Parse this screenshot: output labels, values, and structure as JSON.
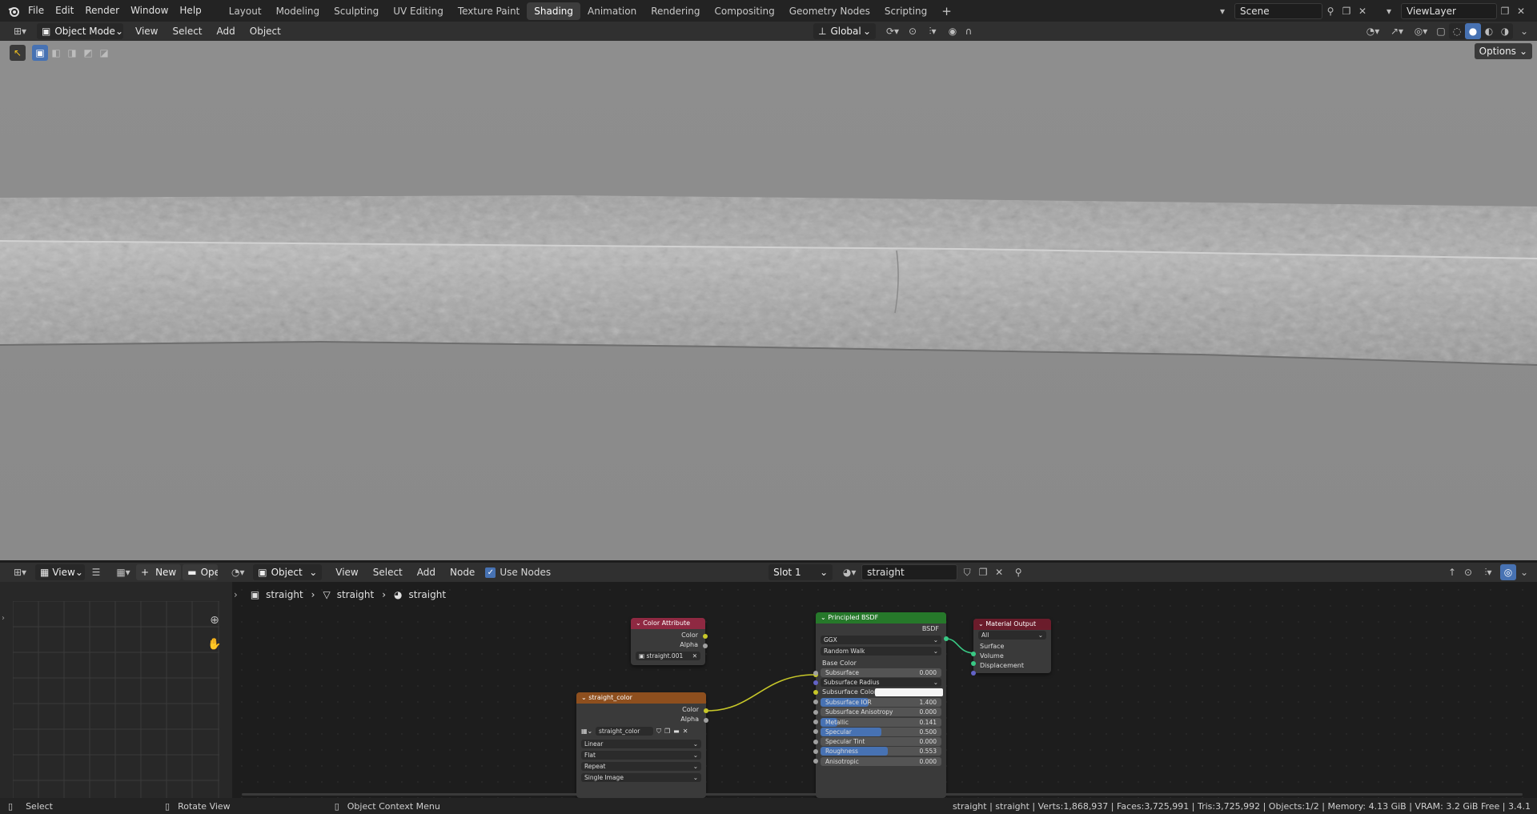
{
  "app": {
    "menus": [
      "File",
      "Edit",
      "Render",
      "Window",
      "Help"
    ],
    "workspaces": [
      "Layout",
      "Modeling",
      "Sculpting",
      "UV Editing",
      "Texture Paint",
      "Shading",
      "Animation",
      "Rendering",
      "Compositing",
      "Geometry Nodes",
      "Scripting"
    ],
    "active_workspace": "Shading",
    "scene": "Scene",
    "view_layer": "ViewLayer"
  },
  "viewport_header": {
    "mode": "Object Mode",
    "menus": [
      "View",
      "Select",
      "Add",
      "Object"
    ],
    "orientation": "Global",
    "options": "Options"
  },
  "node_header": {
    "view": "View",
    "new_label": "New",
    "open_label": "Ope",
    "object_label": "Object",
    "menus": [
      "View",
      "Select",
      "Add",
      "Node"
    ],
    "use_nodes": "Use Nodes",
    "slot": "Slot 1",
    "material": "straight"
  },
  "breadcrumb": [
    "straight",
    "straight",
    "straight"
  ],
  "nodes": {
    "color_attribute": {
      "title": "Color Attribute",
      "out_color": "Color",
      "out_alpha": "Alpha",
      "layer": "straight.001"
    },
    "image_texture": {
      "title": "straight_color",
      "out_color": "Color",
      "out_alpha": "Alpha",
      "image": "straight_color",
      "interpolation": "Linear",
      "projection": "Flat",
      "extension": "Repeat",
      "source": "Single Image"
    },
    "principled": {
      "title": "Principled BSDF",
      "out": "BSDF",
      "distribution": "GGX",
      "subsurface_method": "Random Walk",
      "base_color": "Base Color",
      "fields": [
        {
          "label": "Subsurface",
          "value": "0.000",
          "fill": 0
        },
        {
          "label": "Subsurface Radius",
          "value": "",
          "fill": 0
        },
        {
          "label": "Subsurface Color",
          "value": "",
          "fill": 0
        },
        {
          "label": "Subsurface IOR",
          "value": "1.400",
          "fill": 0.4
        },
        {
          "label": "Subsurface Anisotropy",
          "value": "0.000",
          "fill": 0
        },
        {
          "label": "Metallic",
          "value": "0.141",
          "fill": 0.141
        },
        {
          "label": "Specular",
          "value": "0.500",
          "fill": 0.5
        },
        {
          "label": "Specular Tint",
          "value": "0.000",
          "fill": 0
        },
        {
          "label": "Roughness",
          "value": "0.553",
          "fill": 0.553
        },
        {
          "label": "Anisotropic",
          "value": "0.000",
          "fill": 0
        }
      ]
    },
    "material_output": {
      "title": "Material Output",
      "target": "All",
      "in_surface": "Surface",
      "in_volume": "Volume",
      "in_displacement": "Displacement"
    }
  },
  "status": {
    "select": "Select",
    "rotate": "Rotate View",
    "context": "Object Context Menu",
    "stats": "straight | straight | Verts:1,868,937 | Faces:3,725,991 | Tris:3,725,992 | Objects:1/2 | Memory: 4.13 GiB | VRAM: 3.2 GiB Free | 3.4.1"
  },
  "colors": {
    "accent": "#4772b3",
    "node_attr": "#8f2942",
    "node_tex": "#8e4f1e",
    "node_shader": "#26782a",
    "node_output": "#6b1c2b"
  }
}
